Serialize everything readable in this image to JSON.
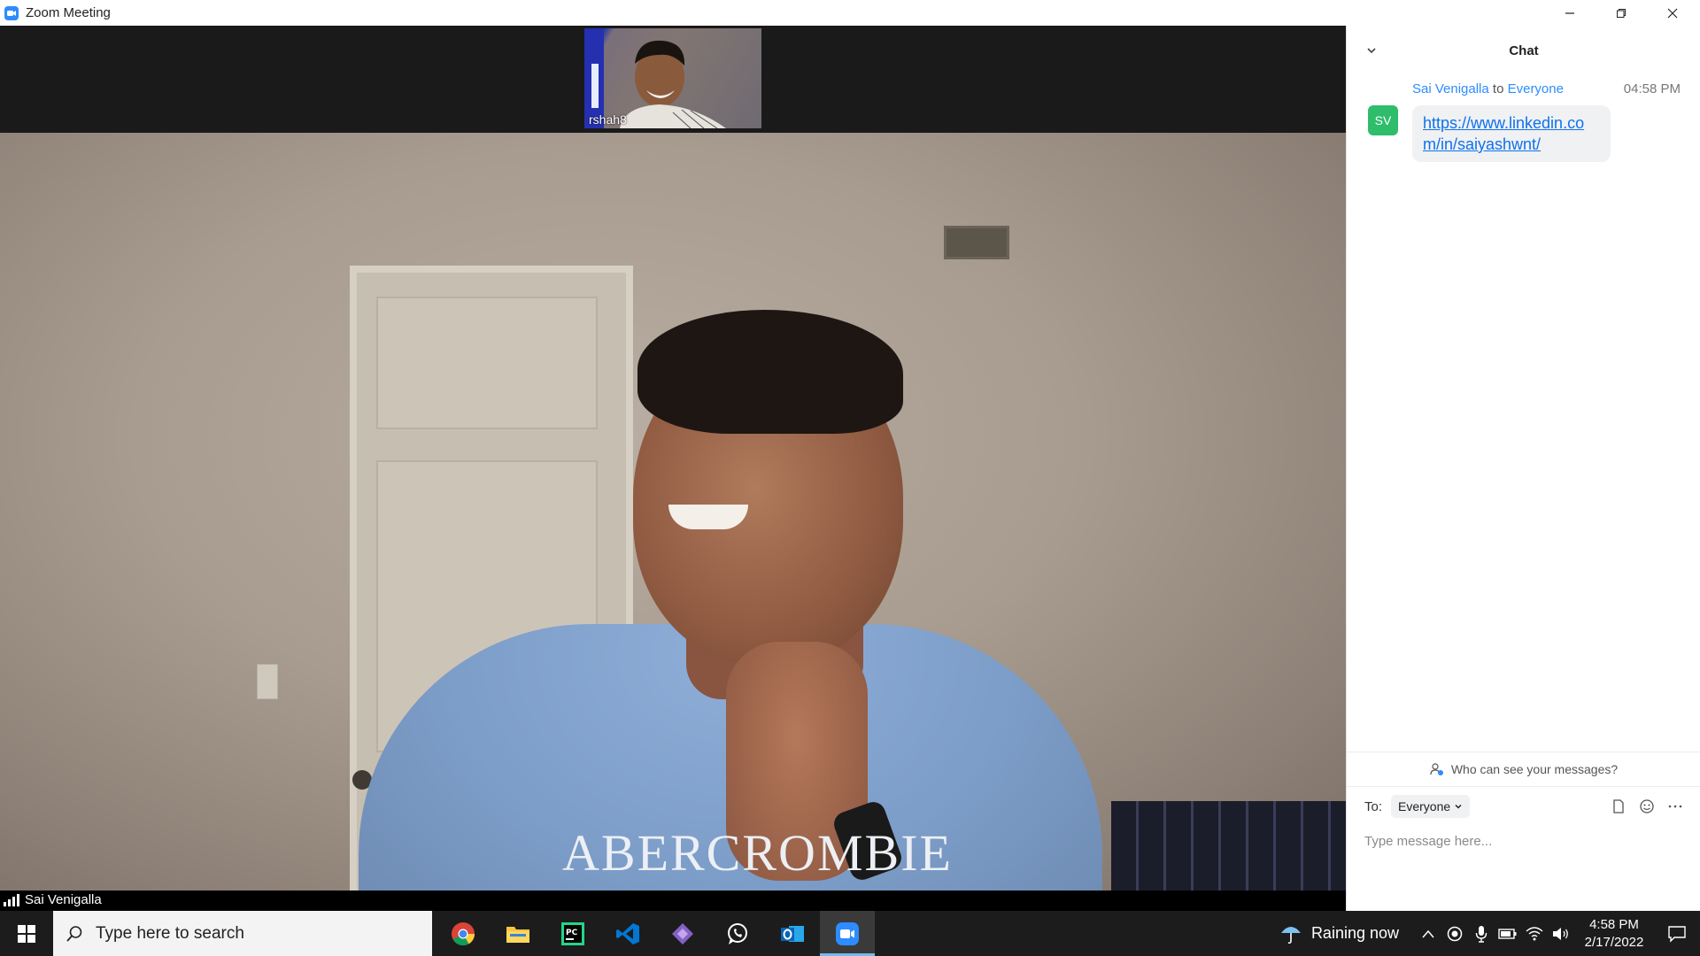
{
  "window": {
    "title": "Zoom Meeting"
  },
  "video": {
    "thumbnail_name": "rshah8",
    "main_name": "Sai Venigalla",
    "shirt_text": "ABERCROMBIE"
  },
  "chat": {
    "title": "Chat",
    "messages": [
      {
        "sender": "Sai Venigalla",
        "to_word": "to",
        "recipient": "Everyone",
        "time": "04:58 PM",
        "initials": "SV",
        "text": "https://www.linkedin.com/in/saiyashwnt/"
      }
    ],
    "who_can_see": "Who can see your messages?",
    "to_label": "To:",
    "to_value": "Everyone",
    "input_placeholder": "Type message here..."
  },
  "taskbar": {
    "search_placeholder": "Type here to search",
    "apps": [
      "chrome-icon",
      "file-explorer-icon",
      "pycharm-icon",
      "vscode-icon",
      "visual-studio-icon",
      "whatsapp-icon",
      "outlook-icon",
      "zoom-icon"
    ],
    "weather": "Raining now",
    "time": "4:58 PM",
    "date": "2/17/2022"
  },
  "colors": {
    "accent": "#2d8cff",
    "avatar": "#2ebd6b",
    "link": "#0e72ed"
  }
}
